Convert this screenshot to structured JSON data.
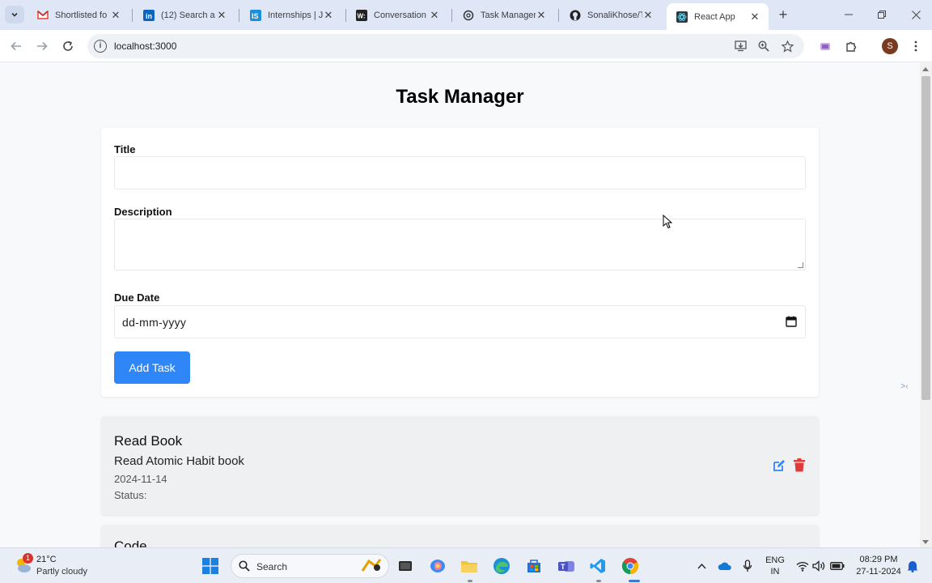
{
  "browser": {
    "tabs": [
      {
        "title": "Shortlisted fo",
        "icon": "gmail-icon"
      },
      {
        "title": "(12) Search a",
        "icon": "linkedin-icon"
      },
      {
        "title": "Internships | J",
        "icon": "internshala-icon"
      },
      {
        "title": "Conversation",
        "icon": "wix-icon"
      },
      {
        "title": "Task Manager",
        "icon": "openai-icon"
      },
      {
        "title": "SonaliKhose/T",
        "icon": "github-icon"
      },
      {
        "title": "React App",
        "icon": "react-icon",
        "active": true
      }
    ],
    "url": "localhost:3000"
  },
  "app": {
    "title": "Task Manager",
    "form": {
      "title_label": "Title",
      "title_value": "",
      "description_label": "Description",
      "description_value": "",
      "due_date_label": "Due Date",
      "due_date_placeholder": "dd-mm-yyyy",
      "add_button": "Add Task"
    },
    "tasks": [
      {
        "title": "Read Book",
        "description": "Read Atomic Habit book",
        "due_date": "2024-11-14",
        "status": "Status:"
      },
      {
        "title": "Code"
      }
    ]
  },
  "taskbar": {
    "weather_temp": "21°C",
    "weather_desc": "Partly cloudy",
    "weather_badge": "1",
    "search_label": "Search",
    "lang_top": "ENG",
    "lang_bottom": "IN",
    "time": "08:29 PM",
    "date": "27-11-2024"
  },
  "colors": {
    "accent_button": "#2f86f6",
    "edit_icon": "#2f86f6",
    "delete_icon": "#e03b3b"
  }
}
